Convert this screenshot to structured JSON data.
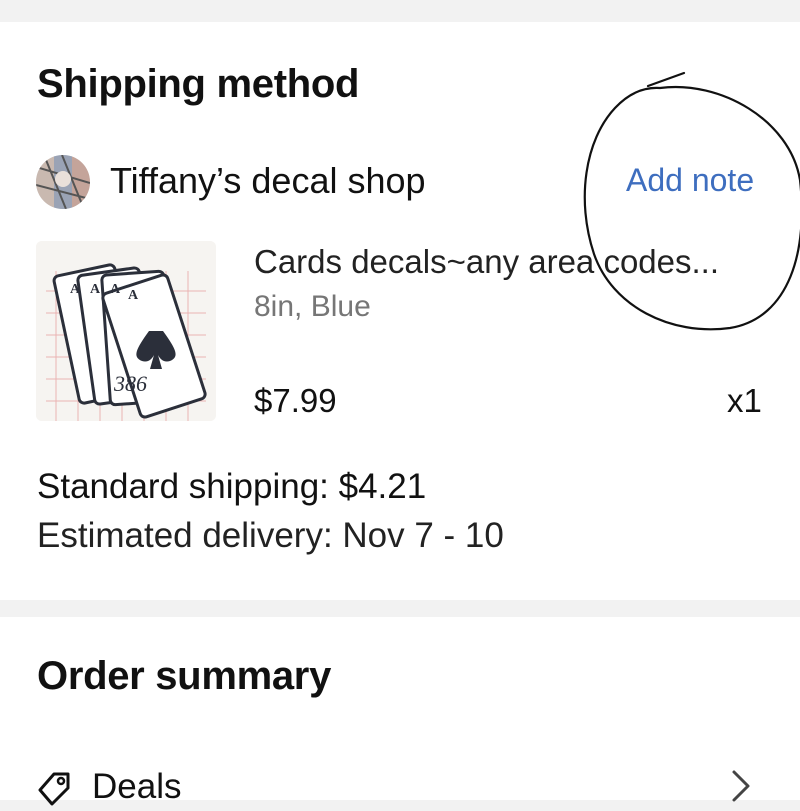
{
  "shipping": {
    "title": "Shipping method",
    "shop_name": "Tiffany’s decal shop",
    "add_note": "Add note",
    "item": {
      "title": "Cards decals~any area codes...",
      "variant": "8in, Blue",
      "price": "$7.99",
      "quantity": "x1",
      "card_number": "386"
    },
    "standard_shipping": "Standard shipping: $4.21",
    "estimated_delivery": "Estimated delivery: Nov 7 - 10"
  },
  "order_summary": {
    "title": "Order summary",
    "deals_label": "Deals"
  },
  "colors": {
    "link": "#3e6ebf",
    "separator": "#f2f2f2",
    "annotation": "#111111"
  },
  "icons": {
    "deals": "tag-icon",
    "deals_chevron": "chevron-right-icon"
  }
}
